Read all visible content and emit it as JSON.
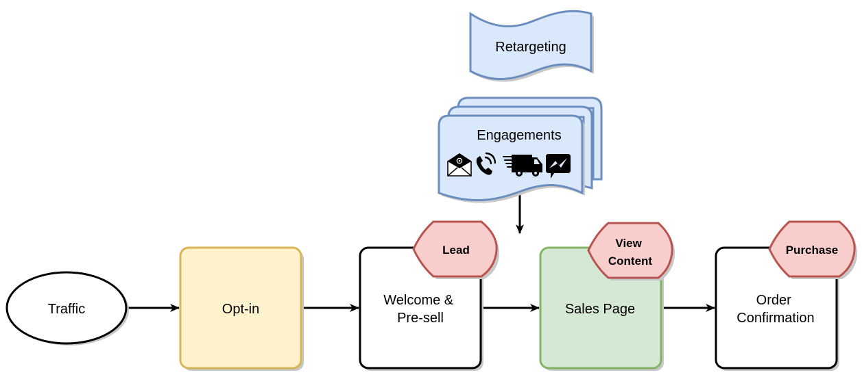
{
  "diagram": {
    "type": "marketing-funnel-flowchart",
    "colors": {
      "stroke_black": "#000000",
      "optin_fill": "#fff2cc",
      "optin_stroke": "#d6b656",
      "sales_fill": "#d5e8d4",
      "sales_stroke": "#82b366",
      "tag_fill": "#f8cecc",
      "tag_stroke": "#b85450",
      "blue_fill": "#dae8fc",
      "blue_stroke": "#6c8ebf",
      "shadow": "#c8c8c8"
    },
    "nodes": {
      "traffic": {
        "label": "Traffic",
        "shape": "ellipse"
      },
      "optin": {
        "label": "Opt-in",
        "shape": "rounded-rect"
      },
      "welcome": {
        "label_lines": [
          "Welcome &",
          "Pre-sell"
        ],
        "shape": "rounded-rect"
      },
      "sales": {
        "label": "Sales Page",
        "shape": "rounded-rect"
      },
      "order": {
        "label_lines": [
          "Order",
          "Confirmation"
        ],
        "shape": "rounded-rect"
      },
      "retargeting": {
        "label": "Retargeting",
        "shape": "tape"
      },
      "engagements": {
        "label": "Engagements",
        "shape": "multi-document",
        "icons": [
          "email-icon",
          "phone-icon",
          "delivery-truck-icon",
          "messenger-icon"
        ]
      }
    },
    "tags": {
      "lead": {
        "label_lines": [
          "Lead"
        ],
        "attached_to": "welcome"
      },
      "view_content": {
        "label_lines": [
          "View",
          "Content"
        ],
        "attached_to": "sales"
      },
      "purchase": {
        "label_lines": [
          "Purchase"
        ],
        "attached_to": "order"
      }
    },
    "edges": [
      {
        "from": "traffic",
        "to": "optin"
      },
      {
        "from": "optin",
        "to": "welcome"
      },
      {
        "from": "welcome",
        "to": "sales"
      },
      {
        "from": "sales",
        "to": "order"
      },
      {
        "from": "engagements",
        "to": "sales"
      }
    ]
  }
}
